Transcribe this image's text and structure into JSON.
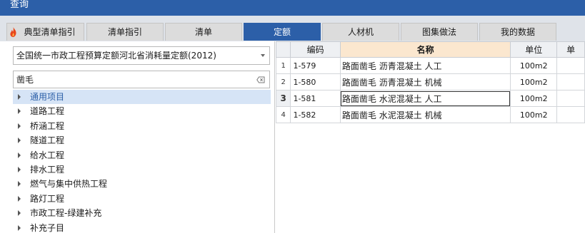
{
  "window": {
    "title": "查询"
  },
  "tabs": [
    {
      "label": "典型清单指引",
      "active": false,
      "icon": "fire-icon"
    },
    {
      "label": "清单指引",
      "active": false
    },
    {
      "label": "清单",
      "active": false
    },
    {
      "label": "定额",
      "active": true
    },
    {
      "label": "人材机",
      "active": false
    },
    {
      "label": "图集做法",
      "active": false
    },
    {
      "label": "我的数据",
      "active": false
    }
  ],
  "library_select": {
    "value": "全国统一市政工程预算定额河北省消耗量定额(2012)"
  },
  "search": {
    "value": "凿毛",
    "clear_icon": "clear-icon"
  },
  "tree": {
    "items": [
      {
        "label": "通用项目",
        "selected": true
      },
      {
        "label": "道路工程"
      },
      {
        "label": "桥涵工程"
      },
      {
        "label": "隧道工程"
      },
      {
        "label": "给水工程"
      },
      {
        "label": "排水工程"
      },
      {
        "label": "燃气与集中供热工程"
      },
      {
        "label": "路灯工程"
      },
      {
        "label": "市政工程-绿建补充"
      },
      {
        "label": "补充子目"
      }
    ]
  },
  "grid": {
    "columns": [
      "",
      "编码",
      "名称",
      "单位",
      "单"
    ],
    "rows": [
      {
        "no": "1",
        "code": "1-579",
        "name": "路面凿毛 沥青混凝土 人工",
        "unit": "100m2"
      },
      {
        "no": "2",
        "code": "1-580",
        "name": "路面凿毛 沥青混凝土 机械",
        "unit": "100m2"
      },
      {
        "no": "3",
        "code": "1-581",
        "name": "路面凿毛 水泥混凝土 人工",
        "unit": "100m2"
      },
      {
        "no": "4",
        "code": "1-582",
        "name": "路面凿毛 水泥混凝土 机械",
        "unit": "100m2"
      }
    ],
    "current_row_index": 2
  },
  "colors": {
    "accent": "#2c5fa8",
    "name_header": "#fbe7cf",
    "selected_tree": "#d6e4f6"
  }
}
